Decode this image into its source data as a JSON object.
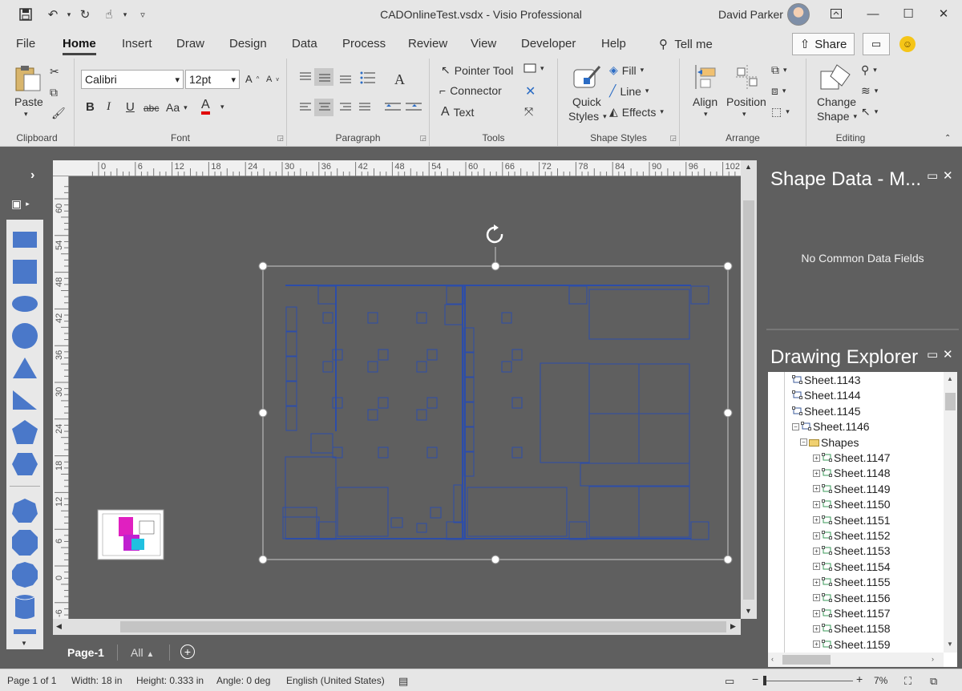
{
  "window": {
    "title": "CADOnlineTest.vsdx  -  Visio Professional",
    "user": "David Parker"
  },
  "tabs": [
    "File",
    "Home",
    "Insert",
    "Draw",
    "Design",
    "Data",
    "Process",
    "Review",
    "View",
    "Developer",
    "Help"
  ],
  "tell_me": "Tell me",
  "share_label": "Share",
  "ribbon": {
    "clipboard": {
      "paste": "Paste",
      "label": "Clipboard"
    },
    "font": {
      "name": "Calibri",
      "size": "12pt",
      "bold": "B",
      "italic": "I",
      "underline": "U",
      "strike": "abc",
      "case": "Aa",
      "color": "A",
      "label": "Font"
    },
    "paragraph": {
      "label": "Paragraph"
    },
    "tools": {
      "pointer": "Pointer Tool",
      "connector": "Connector",
      "text": "Text",
      "label": "Tools"
    },
    "shape_styles": {
      "quick_styles": "Quick",
      "quick_styles2": "Styles",
      "fill": "Fill",
      "line": "Line",
      "effects": "Effects",
      "label": "Shape Styles"
    },
    "arrange": {
      "align": "Align",
      "position": "Position",
      "label": "Arrange"
    },
    "editing": {
      "change_shape": "Change",
      "change_shape2": "Shape",
      "label": "Editing"
    }
  },
  "ruler_top": [
    "0",
    "6",
    "12",
    "18",
    "24",
    "30",
    "36",
    "42",
    "48",
    "54",
    "60",
    "66",
    "72",
    "78",
    "84",
    "90",
    "96",
    "102"
  ],
  "ruler_left": [
    "60",
    "54",
    "48",
    "42",
    "36",
    "30",
    "24",
    "18",
    "12",
    "6",
    "0",
    "-6"
  ],
  "pages": {
    "current": "Page-1",
    "all": "All"
  },
  "shape_data": {
    "title": "Shape Data - M...",
    "empty": "No Common Data Fields"
  },
  "explorer": {
    "title": "Drawing Explorer",
    "items": [
      {
        "label": "Sheet.1143",
        "level": 0
      },
      {
        "label": "Sheet.1144",
        "level": 0
      },
      {
        "label": "Sheet.1145",
        "level": 0
      },
      {
        "label": "Sheet.1146",
        "level": 0,
        "expanded": true
      },
      {
        "label": "Shapes",
        "level": 1,
        "folder": true
      },
      {
        "label": "Sheet.1147",
        "level": 2
      },
      {
        "label": "Sheet.1148",
        "level": 2
      },
      {
        "label": "Sheet.1149",
        "level": 2
      },
      {
        "label": "Sheet.1150",
        "level": 2
      },
      {
        "label": "Sheet.1151",
        "level": 2
      },
      {
        "label": "Sheet.1152",
        "level": 2
      },
      {
        "label": "Sheet.1153",
        "level": 2
      },
      {
        "label": "Sheet.1154",
        "level": 2
      },
      {
        "label": "Sheet.1155",
        "level": 2
      },
      {
        "label": "Sheet.1156",
        "level": 2
      },
      {
        "label": "Sheet.1157",
        "level": 2
      },
      {
        "label": "Sheet.1158",
        "level": 2
      },
      {
        "label": "Sheet.1159",
        "level": 2
      }
    ]
  },
  "status": {
    "page": "Page 1 of 1",
    "width": "Width: 18 in",
    "height": "Height: 0.333 in",
    "angle": "Angle: 0 deg",
    "language": "English (United States)",
    "zoom": "7%"
  },
  "colors": {
    "drawing_line": "#2d4da8",
    "stencil_shape": "#4a78c9",
    "canvas": "#5f5f5f"
  }
}
